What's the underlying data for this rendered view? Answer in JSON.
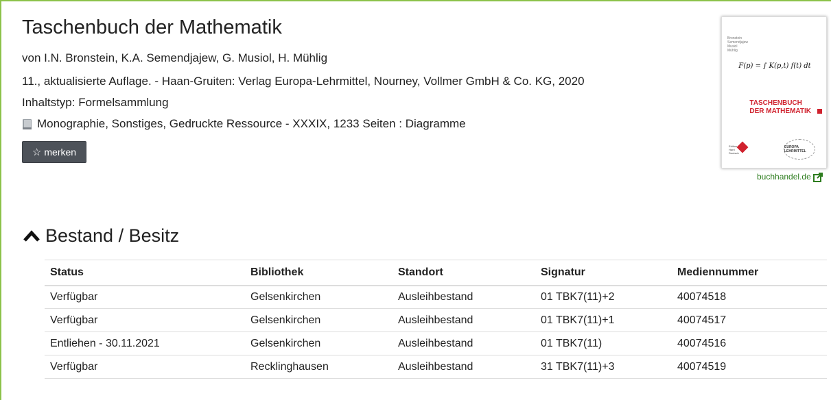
{
  "record": {
    "title": "Taschenbuch der Mathematik",
    "authors": "von I.N. Bronstein, K.A. Semendjajew, G. Musiol, H. Mühlig",
    "edition": "11., aktualisierte Auflage. - Haan-Gruiten: Verlag Europa-Lehrmittel, Nourney, Vollmer GmbH & Co. KG, 2020",
    "content_type": "Inhaltstyp: Formelsammlung",
    "format": "Monographie, Sonstiges, Gedruckte Ressource - XXXIX, 1233 Seiten : Diagramme",
    "format_icon": "book-icon",
    "merken_label": "merken",
    "merken_icon": "star-outline-icon"
  },
  "cover": {
    "authors_lines": [
      "Bronstein",
      "Semendjajew",
      "Musiol",
      "Mühlig"
    ],
    "formula": "F(p) = ∫ K(p,t) f(t) dt",
    "title_line1": "TASCHENBUCH",
    "title_line2": "DER MATHEMATIK",
    "publisher_left": "Edition Harri Deutsch",
    "publisher_right": "EUROPA LEHRMITTEL",
    "accent_color": "#d0222e"
  },
  "buchhandel": {
    "label": "buchhandel.de",
    "icon": "external-link-icon",
    "color": "#2e7d1f"
  },
  "holdings": {
    "heading": "Bestand / Besitz",
    "toggle_icon": "chevron-up-icon",
    "columns": [
      "Status",
      "Bibliothek",
      "Standort",
      "Signatur",
      "Mediennummer"
    ],
    "rows": [
      [
        "Verfügbar",
        "Gelsenkirchen",
        "Ausleihbestand",
        "01 TBK7(11)+2",
        "40074518"
      ],
      [
        "Verfügbar",
        "Gelsenkirchen",
        "Ausleihbestand",
        "01 TBK7(11)+1",
        "40074517"
      ],
      [
        "Entliehen - 30.11.2021",
        "Gelsenkirchen",
        "Ausleihbestand",
        "01 TBK7(11)",
        "40074516"
      ],
      [
        "Verfügbar",
        "Recklinghausen",
        "Ausleihbestand",
        "31 TBK7(11)+3",
        "40074519"
      ]
    ]
  },
  "colors": {
    "frame_border": "#8cc24a",
    "button_bg": "#4d5259"
  }
}
